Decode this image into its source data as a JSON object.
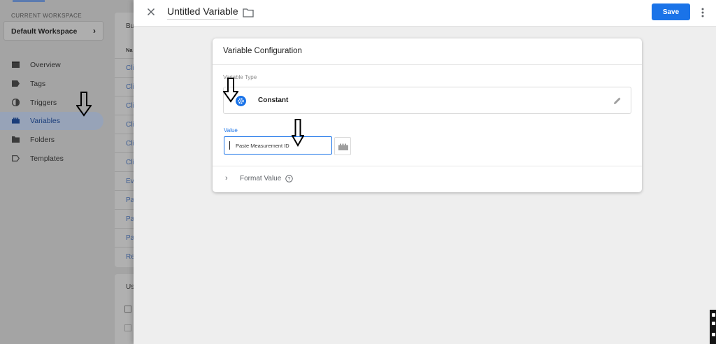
{
  "sidebar": {
    "workspace_label": "CURRENT WORKSPACE",
    "workspace_name": "Default Workspace",
    "items": [
      {
        "label": "Overview"
      },
      {
        "label": "Tags"
      },
      {
        "label": "Triggers"
      },
      {
        "label": "Variables",
        "active": true
      },
      {
        "label": "Folders"
      },
      {
        "label": "Templates"
      }
    ]
  },
  "list_panel": {
    "header": "Bu",
    "column": "Na",
    "rows": [
      "Cli",
      "Cli",
      "Cli",
      "Cli",
      "Cli",
      "Cli",
      "Ev",
      "Pa",
      "Pa",
      "Pa",
      "Re"
    ]
  },
  "user_panel": {
    "header": "Us"
  },
  "sheet": {
    "variable_name": "Untitled Variable",
    "save_label": "Save"
  },
  "card": {
    "title": "Variable Configuration",
    "type_label": "Variable Type",
    "type_name": "Constant",
    "value_label": "Value",
    "value_placeholder": "Paste Measurement ID",
    "format_label": "Format Value"
  },
  "colors": {
    "primary": "#1a73e8",
    "overlay_gray": "#a4a4a4",
    "sheet_bg": "#eeeeee"
  }
}
